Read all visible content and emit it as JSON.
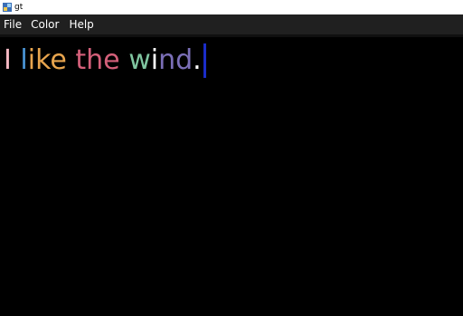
{
  "window": {
    "title": "gt",
    "icon": "app-icon"
  },
  "menu": {
    "items": [
      "File",
      "Color",
      "Help"
    ]
  },
  "editor": {
    "background": "#000000",
    "caret_color": "#1a2cc8",
    "segments": [
      {
        "text": "I",
        "color": "#f4b8c3"
      },
      {
        "text": " ",
        "color": "#ffffff"
      },
      {
        "text": "l",
        "color": "#4a95d6"
      },
      {
        "text": "ike",
        "color": "#e8a54e"
      },
      {
        "text": " ",
        "color": "#ffffff"
      },
      {
        "text": "the",
        "color": "#d4607a"
      },
      {
        "text": " ",
        "color": "#ffffff"
      },
      {
        "text": "w",
        "color": "#7fc5a0"
      },
      {
        "text": "i",
        "color": "#ffffff"
      },
      {
        "text": "nd",
        "color": "#7b6fb8"
      },
      {
        "text": ".",
        "color": "#ffffff"
      }
    ]
  }
}
